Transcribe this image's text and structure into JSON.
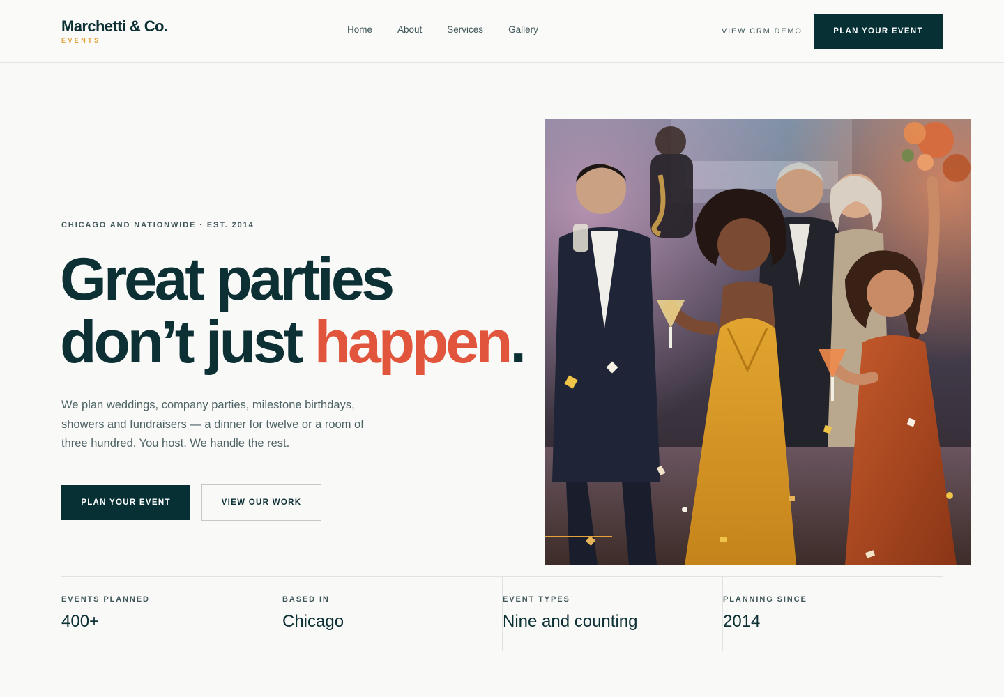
{
  "header": {
    "brand_name": "Marchetti & Co.",
    "brand_sub": "EVENTS",
    "nav": [
      {
        "label": "Home"
      },
      {
        "label": "About"
      },
      {
        "label": "Services"
      },
      {
        "label": "Gallery"
      }
    ],
    "crm_link": "VIEW CRM DEMO",
    "cta": "PLAN YOUR EVENT"
  },
  "hero": {
    "eyebrow": "CHICAGO AND NATIONWIDE · EST. 2014",
    "headline_line1": "Great parties",
    "headline_line2_start": "don’t just ",
    "headline_accent": "happen",
    "headline_end": ".",
    "subcopy": "We plan weddings, company parties, milestone birthdays, showers and fundraisers — a dinner for twelve or a room of three hundred. You host. We handle the rest.",
    "primary_cta": "PLAN YOUR EVENT",
    "secondary_cta": "VIEW OUR WORK",
    "photo": "party-photo"
  },
  "stats": [
    {
      "label": "EVENTS PLANNED",
      "value": "400+"
    },
    {
      "label": "BASED IN",
      "value": "Chicago"
    },
    {
      "label": "EVENT TYPES",
      "value": "Nine and counting"
    },
    {
      "label": "PLANNING SINCE",
      "value": "2014"
    }
  ],
  "colors": {
    "brand_dark": "#073035",
    "accent_coral": "#e0553c",
    "accent_gold": "#e6a33a",
    "background": "#f9f9f7"
  }
}
